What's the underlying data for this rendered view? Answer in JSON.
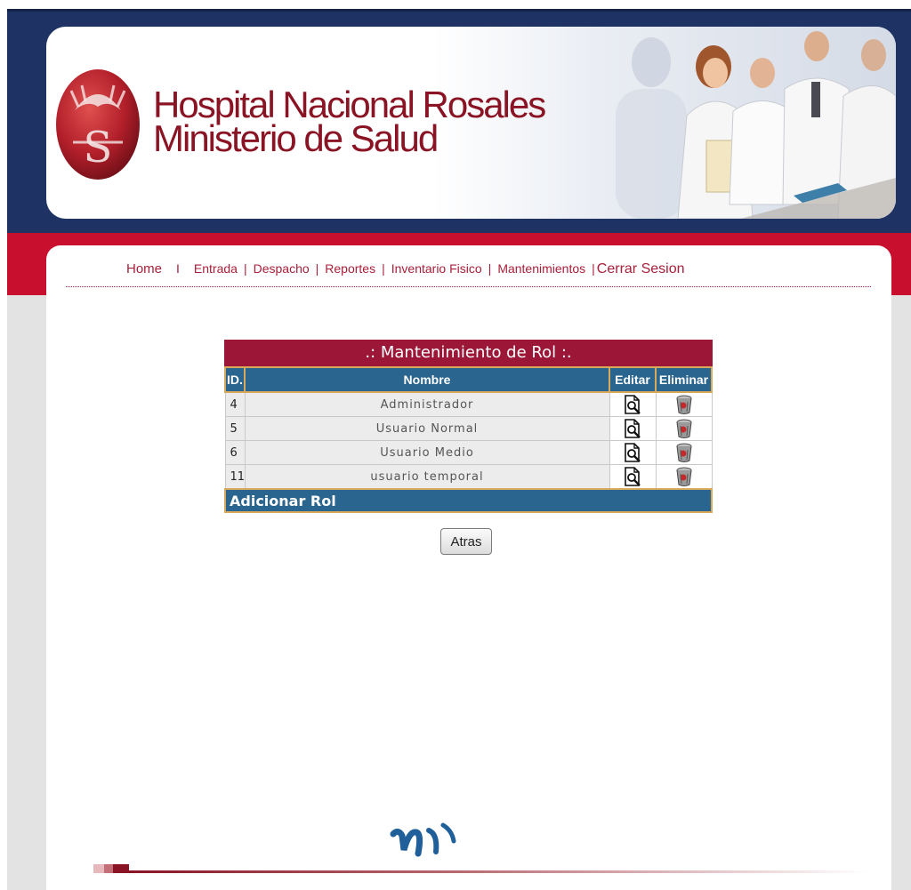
{
  "header": {
    "title_line1": "Hospital Nacional Rosales",
    "title_line2": "Ministerio de Salud"
  },
  "nav": {
    "items": [
      {
        "label": "Home"
      },
      {
        "label": "Entrada"
      },
      {
        "label": "Despacho"
      },
      {
        "label": "Reportes"
      },
      {
        "label": "Inventario Fisico"
      },
      {
        "label": "Mantenimientos"
      },
      {
        "label": "Cerrar Sesion"
      }
    ],
    "separator": "|",
    "home_separator": "I"
  },
  "roles_table": {
    "caption": ".: Mantenimiento de Rol :.",
    "headers": {
      "id": "ID.",
      "name": "Nombre",
      "edit": "Editar",
      "delete": "Eliminar"
    },
    "rows": [
      {
        "id": "4",
        "name": "Administrador"
      },
      {
        "id": "5",
        "name": "Usuario Normal"
      },
      {
        "id": "6",
        "name": "Usuario Medio"
      },
      {
        "id": "11",
        "name": "usuario temporal"
      }
    ],
    "add_label": "Adicionar Rol"
  },
  "back_button": {
    "label": "Atras"
  },
  "colors": {
    "navy": "#1e3263",
    "red": "#c8102e",
    "brand_text": "#8a1424",
    "caption_bg": "#9b1637",
    "header_bg": "#2a6590"
  },
  "icons": {
    "edit": "document-magnifier-icon",
    "delete": "trash-can-icon"
  }
}
